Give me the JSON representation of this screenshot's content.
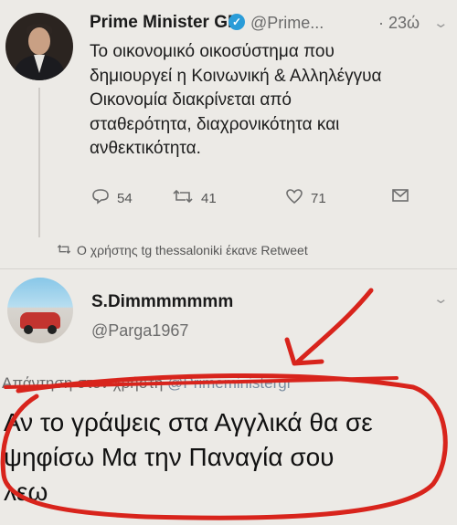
{
  "tweet1": {
    "display_name": "Prime Minister GR",
    "handle": "@Prime...",
    "time": "· 23ώ",
    "text_lines": [
      "Το οικονομικό οικοσύστημα που",
      "δημιουργεί η Κοινωνική & Αλληλέγγυα",
      "Οικονομία διακρίνεται από",
      "σταθερότητα, διαχρονικότητα και",
      "ανθεκτικότητα."
    ],
    "reply_count": "54",
    "retweet_count": "41",
    "like_count": "71"
  },
  "retweet_note": "Ο χρήστης tg thessaloniki έκανε Retweet",
  "tweet2": {
    "display_name": "S.Dimmmmmmm",
    "handle": "@Parga1967",
    "reply_prefix": "Απάντηση στον χρήστη",
    "reply_mention": "@Primeministergr",
    "text_lines": [
      "Αν το γράψεις στα Αγγλικά θα σε",
      "ψηφίσω  Μα την Παναγία σου",
      "λεω"
    ]
  },
  "colors": {
    "verified": "#2a9cd8",
    "scribble_red": "#d8241c",
    "background": "#eceae6"
  },
  "icons": [
    "verified-badge-icon",
    "reply-icon",
    "retweet-icon",
    "like-icon",
    "dm-icon",
    "chevron-down-icon"
  ]
}
